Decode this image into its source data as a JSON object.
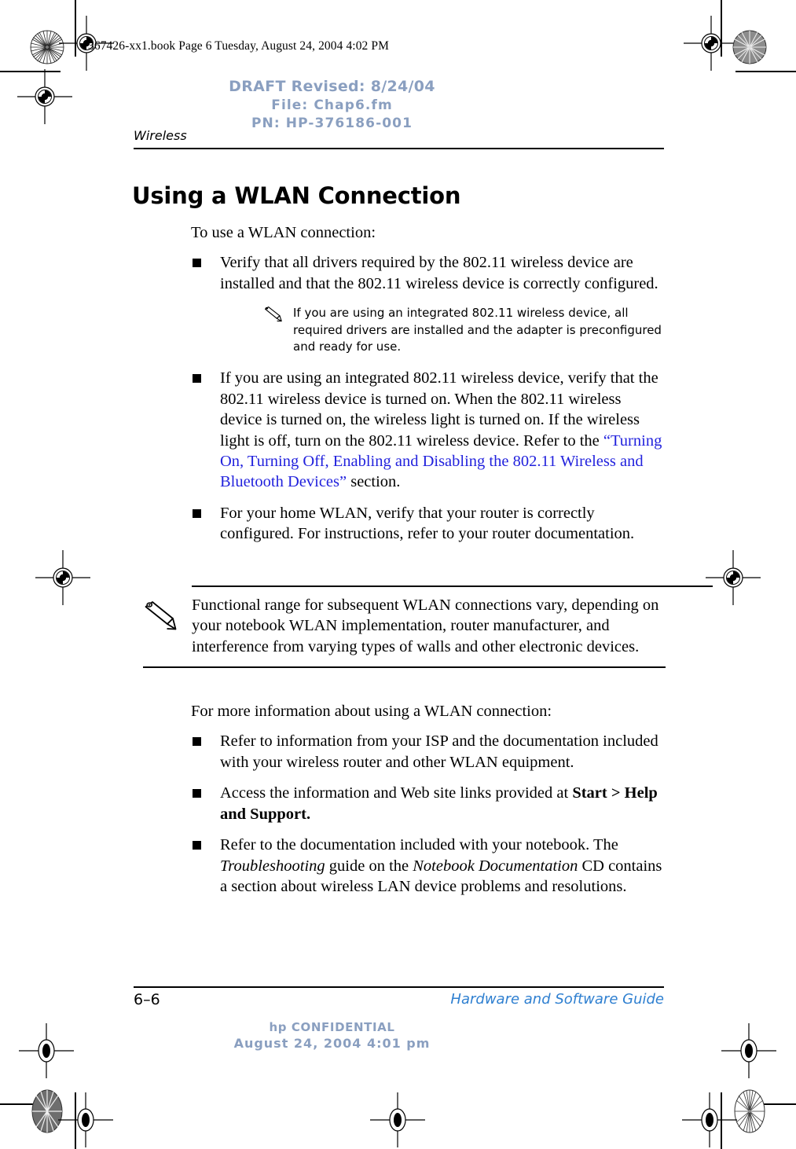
{
  "print_marks": {
    "file_stamp": "367426-xx1.book  Page 6  Tuesday, August 24, 2004  4:02 PM"
  },
  "draft_stamp": {
    "line1": "DRAFT Revised: 8/24/04",
    "line2": "File: Chap6.fm",
    "line3": "PN: HP-376186-001",
    "color": "#8a9fc0"
  },
  "running_head": {
    "chapter": "Wireless"
  },
  "page": {
    "title": "Using a WLAN Connection",
    "lead_paragraph": "To use a WLAN connection:",
    "bullets_top": [
      {
        "text": "Verify that all drivers required by the 802.11 wireless device are installed and that the 802.11 wireless device is correctly configured."
      },
      {
        "pre_link": "If you are using an integrated 802.11 wireless device, verify that the 802.11 wireless device is turned on. When the 802.11 wireless device is turned on, the wireless light is turned on. If the wireless light is off, turn on the 802.11 wireless device. Refer to the ",
        "link": "“Turning On, Turning Off, Enabling and Disabling the 802.11 Wireless and Bluetooth Devices”",
        "post_link": " section.",
        "link_color": "#2222dd"
      },
      {
        "text": "For your home WLAN, verify that your router is correctly configured. For instructions, refer to your router documentation."
      }
    ],
    "note_small": {
      "icon": "pencil-icon",
      "text": "If you are using an integrated 802.11 wireless device, all required drivers are installed and the adapter is preconfigured and ready for use."
    },
    "note_big": {
      "icon": "pencil-icon",
      "text": "Functional range for subsequent WLAN connections vary, depending on your notebook WLAN implementation, router manufacturer, and interference from varying types of walls and other electronic devices."
    },
    "lead_paragraph_2": "For more information about using a WLAN connection:",
    "bullets_bottom": [
      {
        "text": "Refer to information from your ISP and the documentation included with your wireless router and other WLAN equipment."
      },
      {
        "pre_bold": "Access the information and Web site links provided at ",
        "bold": "Start > Help and Support.",
        "post_bold": ""
      },
      {
        "seg1": "Refer to the documentation included with your notebook. The ",
        "italic1": "Troubleshooting",
        "seg2": " guide on the ",
        "italic2": "Notebook Documentation",
        "seg3": " CD contains a section about wireless LAN device problems and resolutions."
      }
    ]
  },
  "footer": {
    "page_number": "6–6",
    "guide_name": "Hardware and Software Guide",
    "guide_color": "#2e7fd0",
    "confidential_line1": "hp CONFIDENTIAL",
    "confidential_line2": "August 24, 2004 4:01 pm",
    "confidential_color": "#8a9fc0"
  }
}
